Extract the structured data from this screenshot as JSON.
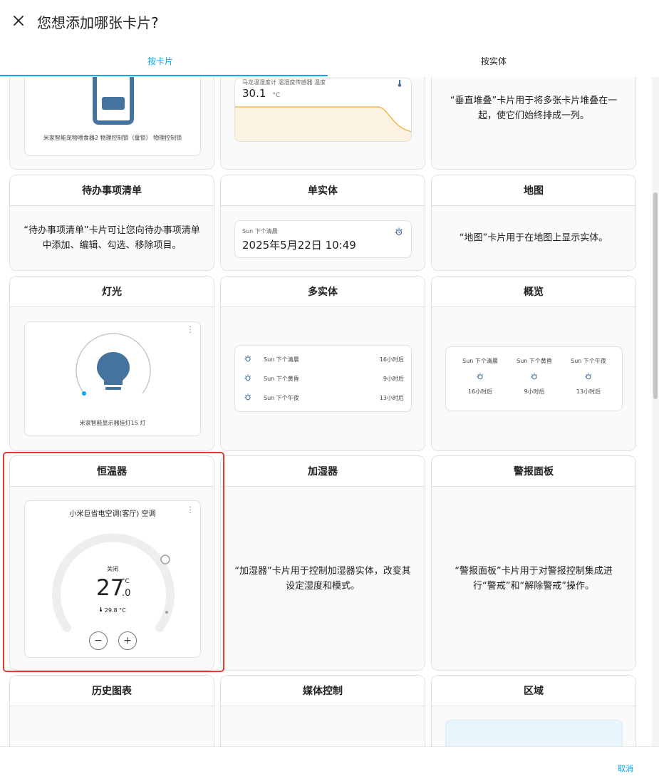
{
  "dialog": {
    "title": "您想添加哪张卡片?",
    "tabs": [
      "按卡片",
      "按实体"
    ],
    "cancel": "取消"
  },
  "top_row": {
    "pet_feeder_caption": "米家智能宠物喂食器2 物理控制锁（童锁） 物理控制锁",
    "sensor_name": "马龙温湿度计 温湿度传感器 温度",
    "sensor_value": "30.1",
    "sensor_unit": "°C",
    "vertical_stack_desc": "“垂直堆叠”卡片用于将多张卡片堆叠在一起，使它们始终排成一列。"
  },
  "cards": {
    "todo": {
      "title": "待办事项清单",
      "desc": "“待办事项清单”卡片可让您向待办事项清单中添加、编辑、勾选、移除项目。"
    },
    "entity": {
      "title": "单实体",
      "label": "Sun 下个清晨",
      "value": "2025年5月22日 10:49"
    },
    "map": {
      "title": "地图",
      "desc": "“地图”卡片用于在地图上显示实体。"
    },
    "light": {
      "title": "灯光",
      "caption": "米家智能显示器挂灯1S 灯"
    },
    "entities": {
      "title": "多实体",
      "rows": [
        {
          "label": "Sun 下个清晨",
          "value": "16小时后"
        },
        {
          "label": "Sun 下个黄昏",
          "value": "9小时后"
        },
        {
          "label": "Sun 下个午夜",
          "value": "13小时后"
        }
      ]
    },
    "glance": {
      "title": "概览",
      "items": [
        {
          "label": "Sun 下个清晨",
          "value": "16小时后"
        },
        {
          "label": "Sun 下个黄昏",
          "value": "9小时后"
        },
        {
          "label": "Sun 下个午夜",
          "value": "13小时后"
        }
      ]
    },
    "thermostat": {
      "title": "恒温器",
      "name": "小米巨省电空调(客厅) 空调",
      "mode": "关闭",
      "target_int": "27",
      "target_unit": "°C",
      "target_dec": ".0",
      "current": "29.8 °C",
      "minus": "−",
      "plus": "+"
    },
    "humidifier": {
      "title": "加湿器",
      "desc": "“加湿器”卡片用于控制加湿器实体，改变其设定湿度和模式。"
    },
    "alarm": {
      "title": "警报面板",
      "desc": "“警报面板”卡片用于对警报控制集成进行“警戒”和“解除警戒”操作。"
    },
    "history": {
      "title": "历史图表"
    },
    "media": {
      "title": "媒体控制"
    },
    "area": {
      "title": "区域"
    }
  },
  "colors": {
    "accent": "#03a9f4",
    "icon": "#44739e",
    "highlight": "#e53935",
    "graph_fill": "#fdf3e3",
    "graph_line": "#f5b548"
  }
}
